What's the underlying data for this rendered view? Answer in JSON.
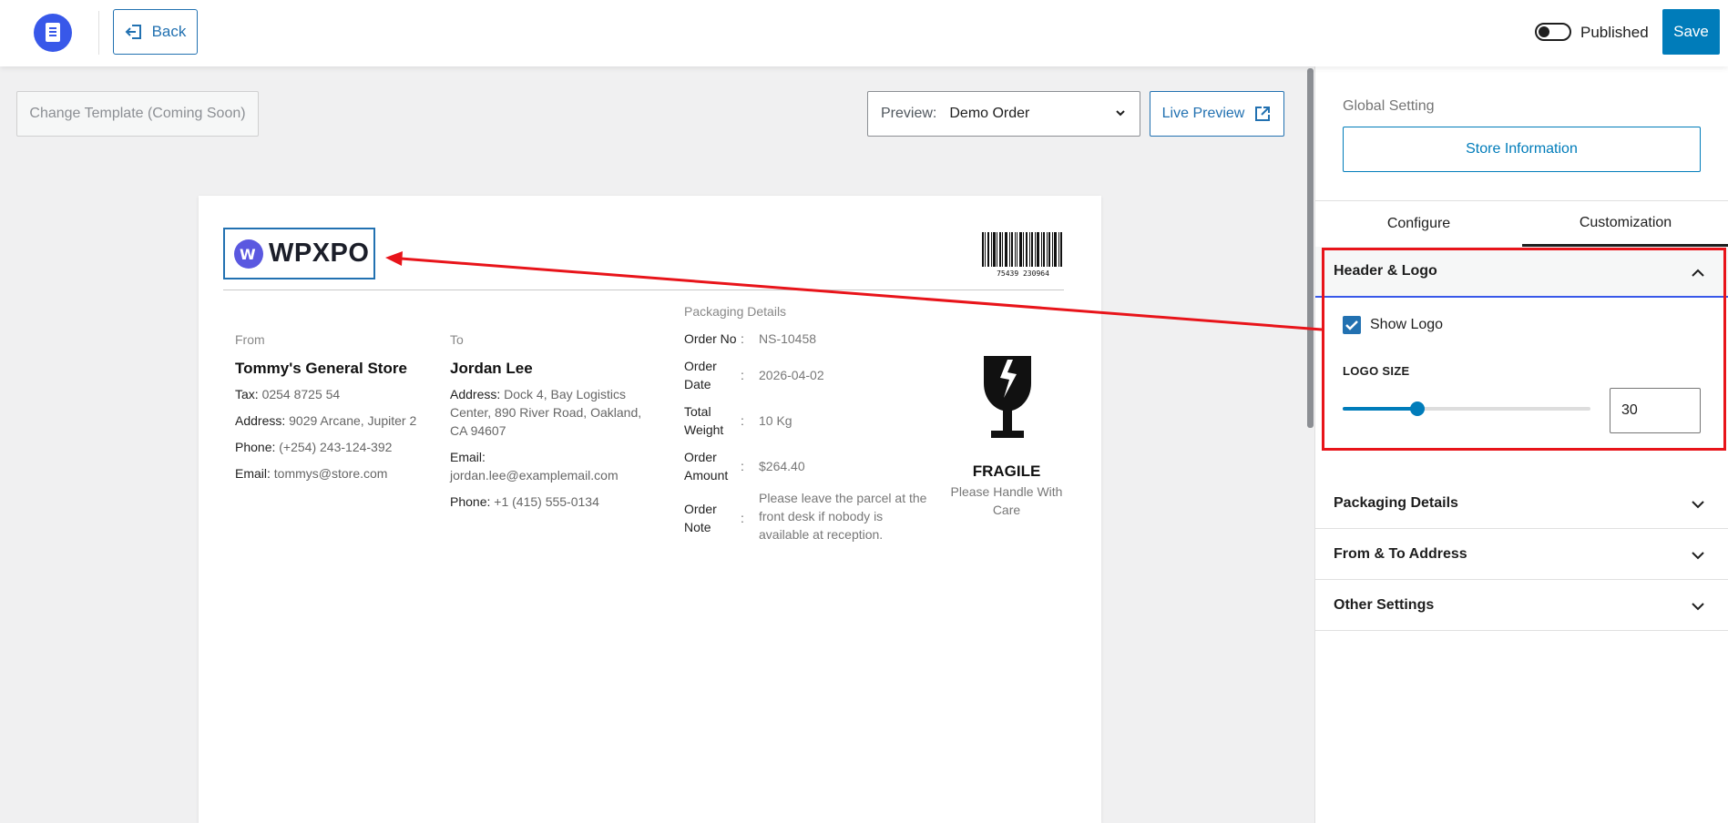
{
  "topbar": {
    "back_label": "Back",
    "published_label": "Published",
    "published_on": false,
    "save_label": "Save"
  },
  "canvas": {
    "change_template_label": "Change Template (Coming Soon)",
    "preview_label": "Preview:",
    "preview_value": "Demo Order",
    "live_preview_label": "Live Preview"
  },
  "label": {
    "logo_text": "WPXPO",
    "barcode_text": "75439 230964",
    "from": {
      "heading": "From",
      "name": "Tommy's General Store",
      "tax_key": "Tax:",
      "tax_val": "0254 8725 54",
      "address_key": "Address:",
      "address_val": "9029 Arcane, Jupiter 2",
      "phone_key": "Phone:",
      "phone_val": "(+254) 243-124-392",
      "email_key": "Email:",
      "email_val": "tommys@store.com"
    },
    "to": {
      "heading": "To",
      "name": "Jordan Lee",
      "address_key": "Address:",
      "address_val": "Dock 4, Bay Logistics Center, 890 River Road, Oakland, CA 94607",
      "email_key": "Email:",
      "email_val": "jordan.lee@examplemail.com",
      "phone_key": "Phone:",
      "phone_val": "+1 (415) 555-0134"
    },
    "packaging": {
      "title": "Packaging Details",
      "rows": [
        {
          "key": "Order No",
          "val": "NS-10458"
        },
        {
          "key": "Order Date",
          "val": "2026-04-02"
        },
        {
          "key": "Total Weight",
          "val": "10 Kg"
        },
        {
          "key": "Order Amount",
          "val": "$264.40"
        },
        {
          "key": "Order Note",
          "val": "Please leave the parcel at the front desk if nobody is available at reception."
        }
      ]
    },
    "fragile": {
      "title": "FRAGILE",
      "subtitle": "Please Handle With Care"
    }
  },
  "sidebar": {
    "global_label": "Global Setting",
    "store_button": "Store Information",
    "tabs": [
      "Configure",
      "Customization"
    ],
    "active_tab": "Customization",
    "sections": {
      "header_logo": "Header & Logo",
      "packaging": "Packaging Details",
      "address": "From & To Address",
      "other": "Other Settings"
    },
    "show_logo_label": "Show Logo",
    "show_logo_checked": true,
    "logo_size_label": "LOGO SIZE",
    "logo_size_value": "30",
    "logo_size_fraction": 0.3
  },
  "colors": {
    "accent": "#007cba",
    "annotation": "#e8141a",
    "brand_circle": "#5a58e0"
  }
}
